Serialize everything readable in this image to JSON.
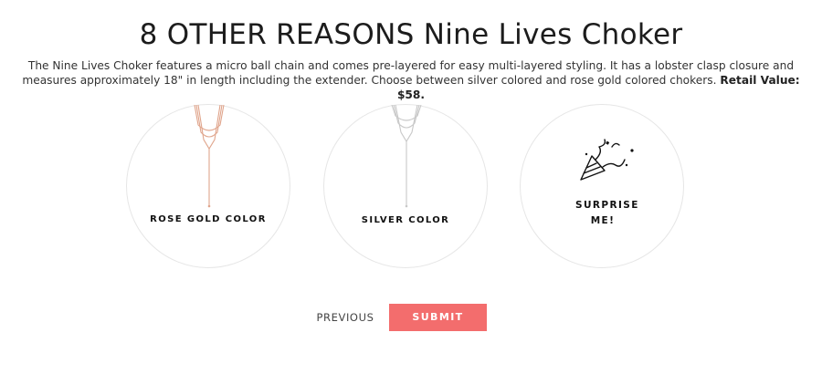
{
  "page": {
    "title": "8 OTHER REASONS Nine Lives Choker",
    "description": "The Nine Lives Choker features a micro ball chain and comes pre-layered for easy multi-layered styling. It has a lobster clasp closure and measures approximately 18\" in length including the extender. Choose between silver colored and rose gold colored chokers.",
    "retail_value": "Retail Value: $58."
  },
  "options": [
    {
      "label": "ROSE GOLD COLOR",
      "icon": "rose-gold-necklace-icon",
      "color": "#e0a58c"
    },
    {
      "label": "SILVER COLOR",
      "icon": "silver-necklace-icon",
      "color": "#c8c8c8"
    },
    {
      "label_line1": "SURPRISE",
      "label_line2": "ME!",
      "icon": "party-popper-icon"
    }
  ],
  "nav": {
    "previous_label": "PREVIOUS",
    "submit_label": "SUBMIT",
    "submit_color": "#f36d6d"
  }
}
